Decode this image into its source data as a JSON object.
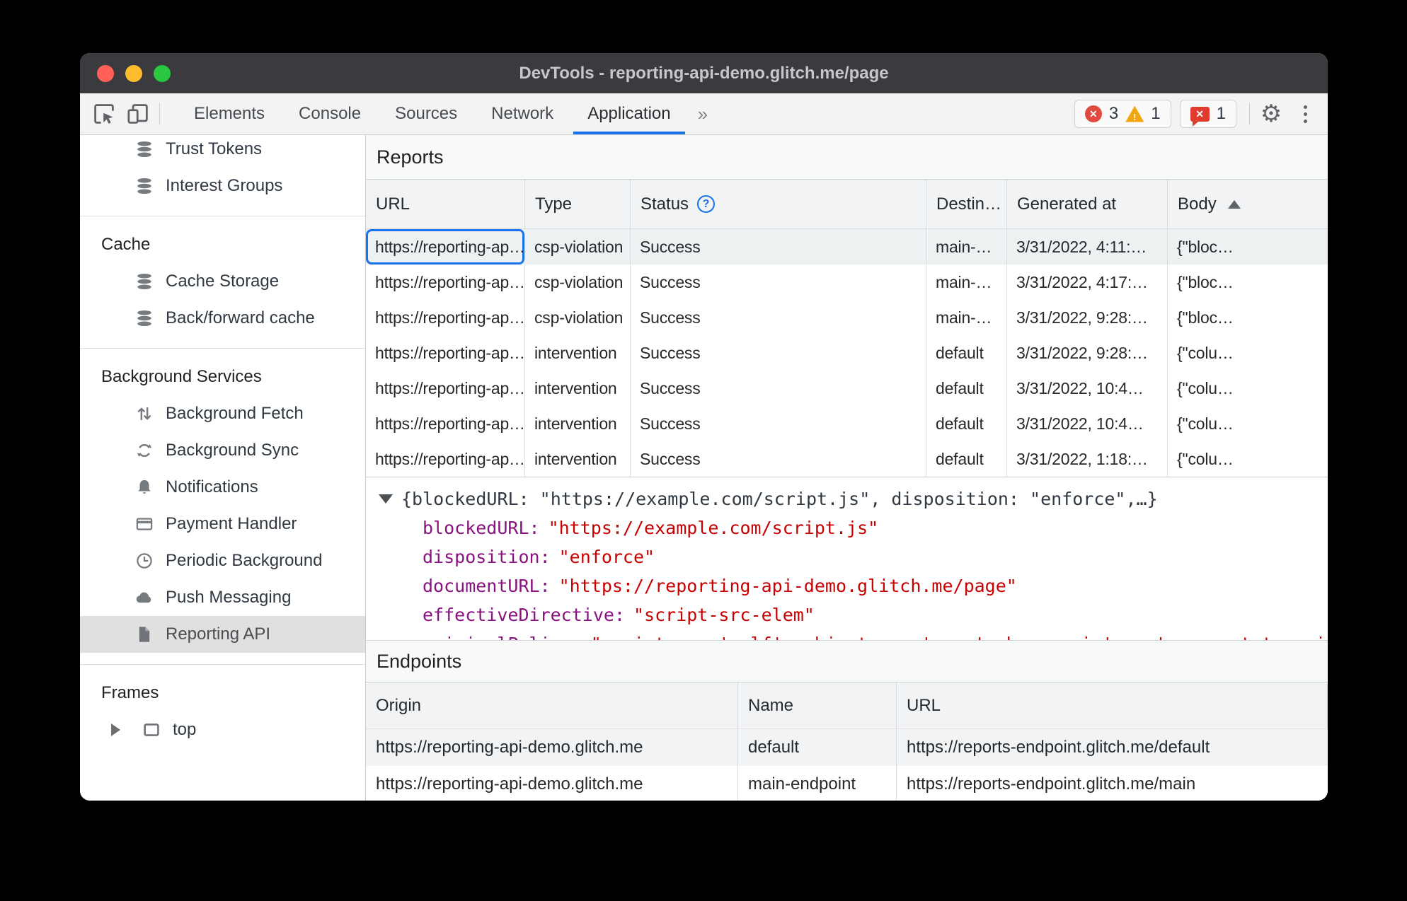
{
  "window": {
    "title": "DevTools - reporting-api-demo.glitch.me/page"
  },
  "icons": {
    "gear": "⚙",
    "error_x": "✕",
    "issue_x": "✕",
    "warning_mark": "!",
    "help": "?"
  },
  "toolbar": {
    "tabs": [
      "Elements",
      "Console",
      "Sources",
      "Network",
      "Application"
    ],
    "active_tab": "Application",
    "more_tabs_chevron": "»",
    "error_count": "3",
    "warning_count": "1",
    "issue_count": "1"
  },
  "sidebar": {
    "storage_items": [
      {
        "label": "Trust Tokens"
      },
      {
        "label": "Interest Groups"
      }
    ],
    "cache": {
      "title": "Cache",
      "items": [
        {
          "label": "Cache Storage"
        },
        {
          "label": "Back/forward cache"
        }
      ]
    },
    "background_services": {
      "title": "Background Services",
      "items": [
        {
          "label": "Background Fetch"
        },
        {
          "label": "Background Sync"
        },
        {
          "label": "Notifications"
        },
        {
          "label": "Payment Handler"
        },
        {
          "label": "Periodic Background"
        },
        {
          "label": "Push Messaging"
        },
        {
          "label": "Reporting API"
        }
      ]
    },
    "frames": {
      "title": "Frames",
      "items": [
        {
          "label": "top"
        }
      ]
    }
  },
  "reports": {
    "title": "Reports",
    "columns": {
      "url": "URL",
      "type": "Type",
      "status": "Status",
      "destination": "Destin…",
      "generated_at": "Generated at",
      "body": "Body"
    },
    "rows": [
      {
        "url": "https://reporting-ap…",
        "type": "csp-violation",
        "status": "Success",
        "destination": "main-…",
        "generated_at": "3/31/2022, 4:11:…",
        "body": "{\"bloc…"
      },
      {
        "url": "https://reporting-ap…",
        "type": "csp-violation",
        "status": "Success",
        "destination": "main-…",
        "generated_at": "3/31/2022, 4:17:…",
        "body": "{\"bloc…"
      },
      {
        "url": "https://reporting-ap…",
        "type": "csp-violation",
        "status": "Success",
        "destination": "main-…",
        "generated_at": "3/31/2022, 9:28:…",
        "body": "{\"bloc…"
      },
      {
        "url": "https://reporting-ap…",
        "type": "intervention",
        "status": "Success",
        "destination": "default",
        "generated_at": "3/31/2022, 9:28:…",
        "body": "{\"colu…"
      },
      {
        "url": "https://reporting-ap…",
        "type": "intervention",
        "status": "Success",
        "destination": "default",
        "generated_at": "3/31/2022, 10:4…",
        "body": "{\"colu…"
      },
      {
        "url": "https://reporting-ap…",
        "type": "intervention",
        "status": "Success",
        "destination": "default",
        "generated_at": "3/31/2022, 10:4…",
        "body": "{\"colu…"
      },
      {
        "url": "https://reporting-ap…",
        "type": "intervention",
        "status": "Success",
        "destination": "default",
        "generated_at": "3/31/2022, 1:18:…",
        "body": "{\"colu…"
      }
    ],
    "detail": {
      "preview": "{blockedURL: \"https://example.com/script.js\", disposition: \"enforce\",…}",
      "fields": [
        {
          "key": "blockedURL:",
          "value": "\"https://example.com/script.js\""
        },
        {
          "key": "disposition:",
          "value": "\"enforce\""
        },
        {
          "key": "documentURL:",
          "value": "\"https://reporting-api-demo.glitch.me/page\""
        },
        {
          "key": "effectiveDirective:",
          "value": "\"script-src-elem\""
        },
        {
          "key": "originalPolicy:",
          "value": "\"script-src 'self'; object-src 'none'; base-uri 'none'; report-to main-endpoint\""
        }
      ]
    }
  },
  "endpoints": {
    "title": "Endpoints",
    "columns": {
      "origin": "Origin",
      "name": "Name",
      "url": "URL"
    },
    "rows": [
      {
        "origin": "https://reporting-api-demo.glitch.me",
        "name": "default",
        "url": "https://reports-endpoint.glitch.me/default"
      },
      {
        "origin": "https://reporting-api-demo.glitch.me",
        "name": "main-endpoint",
        "url": "https://reports-endpoint.glitch.me/main"
      }
    ]
  },
  "colors": {
    "accent": "#1a73e8",
    "error": "#d93025",
    "warning": "#f0a30a",
    "json_key": "#881280",
    "json_string": "#c80000"
  }
}
